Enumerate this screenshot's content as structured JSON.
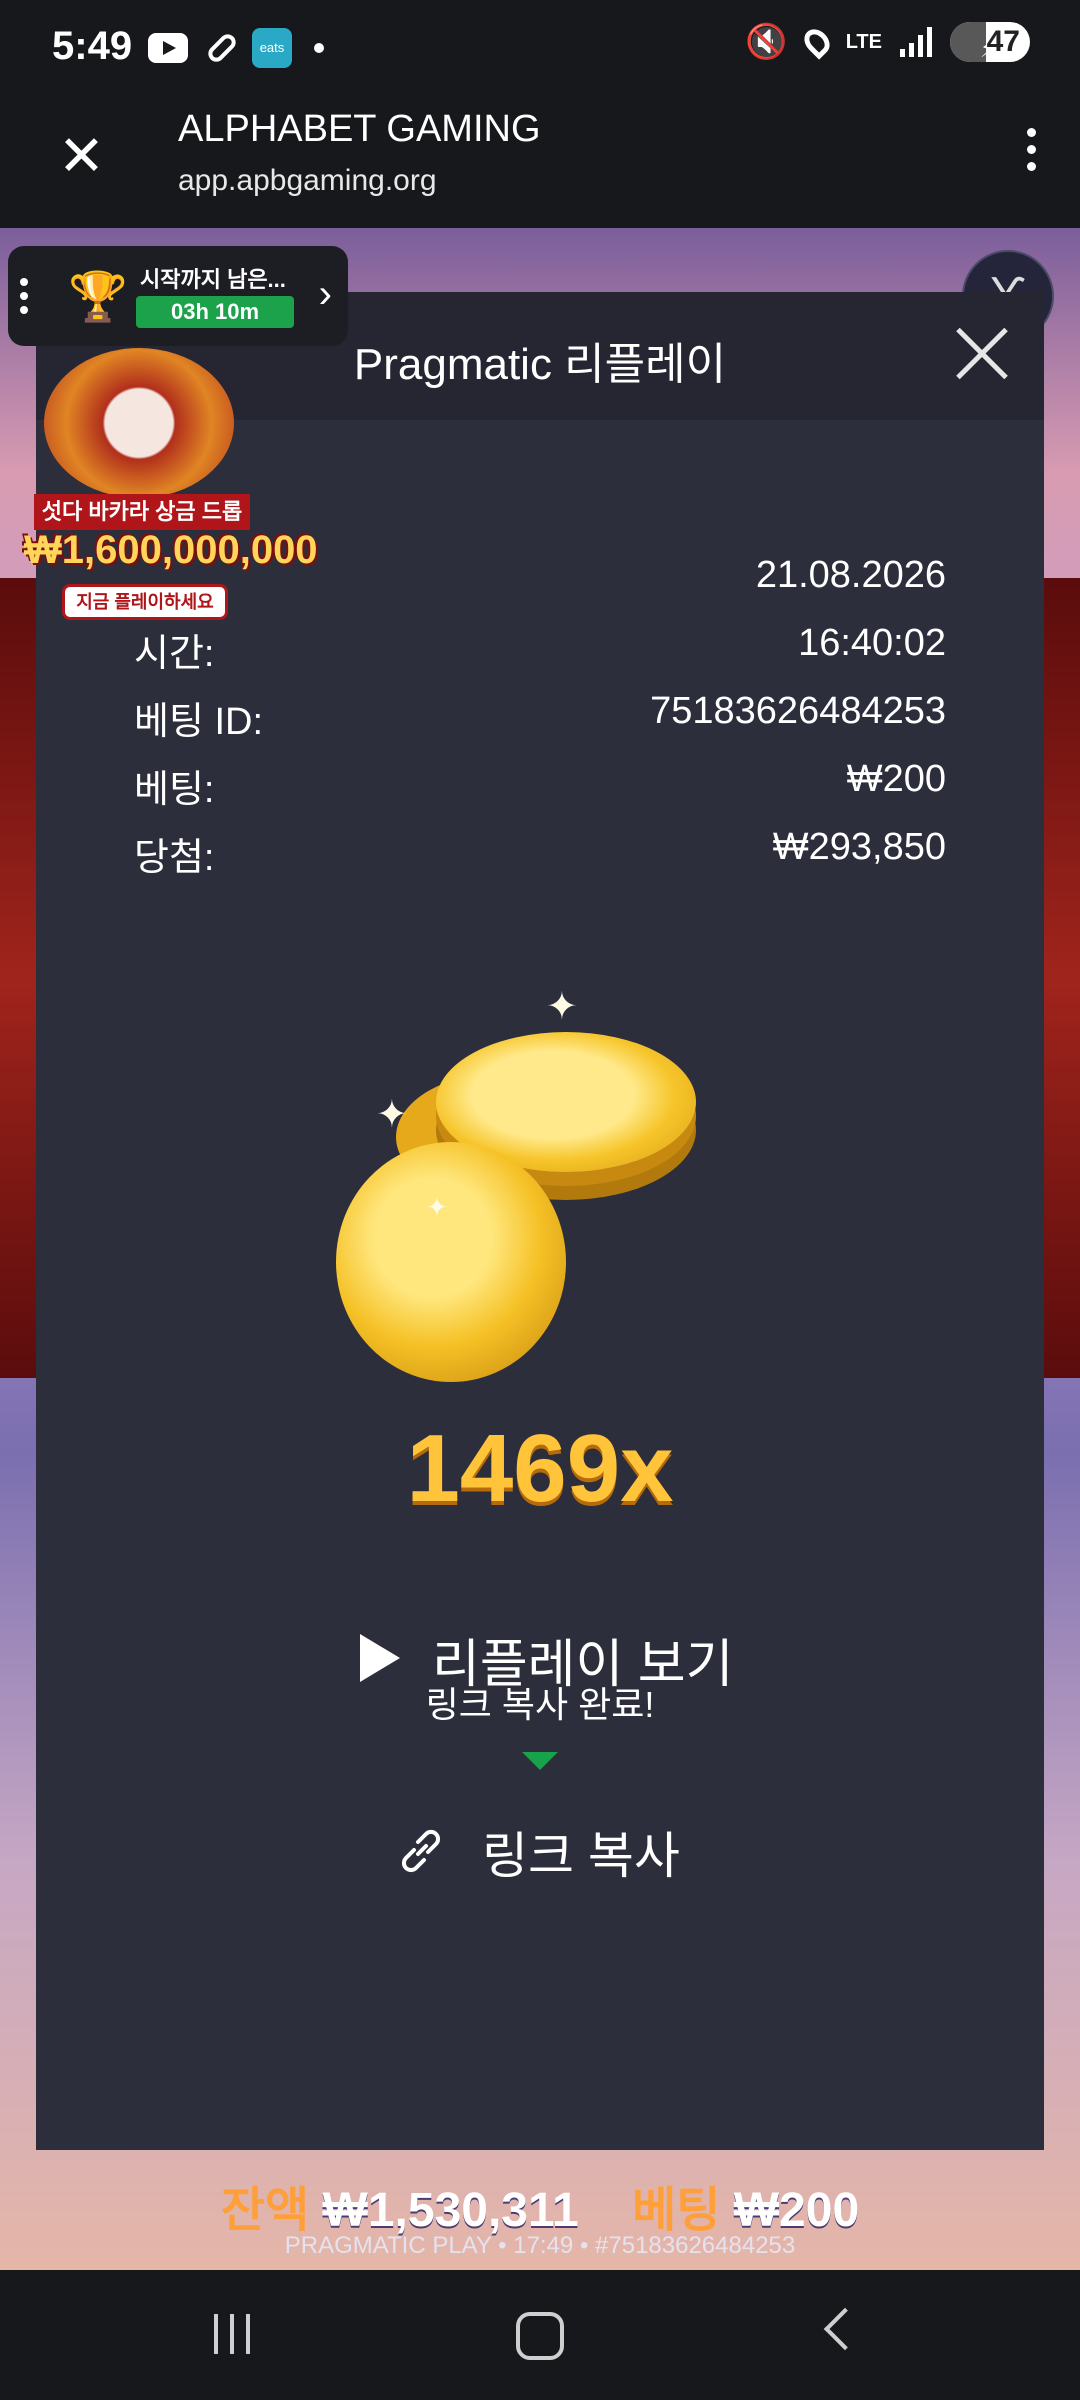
{
  "status_bar": {
    "time": "5:49",
    "eats_label": "eats",
    "network": "LTE",
    "battery": "47"
  },
  "browser": {
    "title": "ALPHABET GAMING",
    "url": "app.apbgaming.org"
  },
  "tournament": {
    "label": "시작까지 남은...",
    "timer": "03h 10m"
  },
  "promo": {
    "title": "섯다 바카라 상금 드롭",
    "amount": "₩1,600,000,000",
    "cta": "지금 플레이하세요"
  },
  "modal": {
    "title": "Pragmatic 리플레이",
    "rows": [
      {
        "key": "",
        "value": "21.08.2026"
      },
      {
        "key": "시간:",
        "value": "16:40:02"
      },
      {
        "key": "베팅 ID:",
        "value": "75183626484253"
      },
      {
        "key": "베팅:",
        "value": "₩200"
      },
      {
        "key": "당첨:",
        "value": "₩293,850"
      }
    ],
    "multiplier": "1469x",
    "replay_label": "리플레이 보기",
    "toast": "링크 복사 완료!",
    "copy_label": "링크 복사"
  },
  "footer": {
    "balance_label": "잔액",
    "balance_value": "₩1,530,311",
    "bet_label": "베팅",
    "bet_value": "₩200",
    "sub": "PRAGMATIC PLAY • 17:49 • #75183626484253"
  },
  "colors": {
    "accent_gold": "#ffc43a",
    "toast_green": "#18a34a",
    "modal_bg": "#2d2e3b"
  }
}
